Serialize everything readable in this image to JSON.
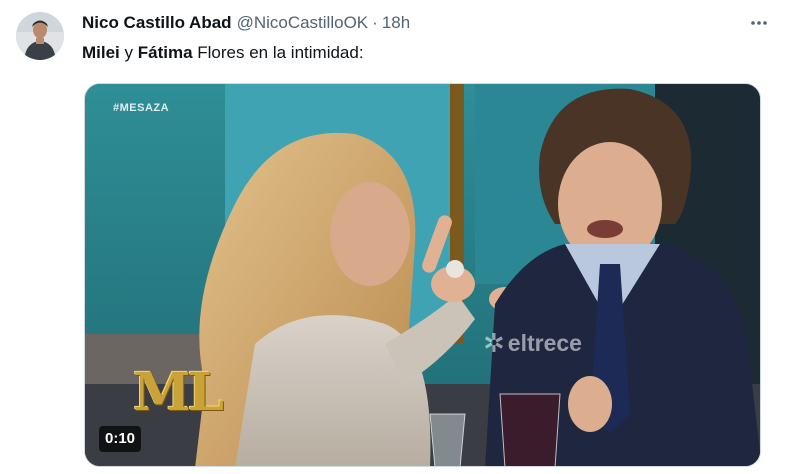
{
  "author": {
    "display_name": "Nico Castillo Abad",
    "handle": "@NicoCastilloOK",
    "separator": "·",
    "time": "18h"
  },
  "tweet": {
    "text_parts": [
      "Milei",
      " y ",
      "Fátima",
      " Flores en la intimidad:"
    ]
  },
  "media": {
    "channel_tag": "#MESAZA",
    "watermark": "eltrece",
    "show_logo": "ML",
    "duration": "0:10"
  },
  "icons": {
    "more": "more-horizontal-icon",
    "watermark_logo": "eltrece-logo-icon"
  },
  "colors": {
    "text_primary": "#0f1419",
    "text_secondary": "#536471",
    "border": "#cfd9de",
    "studio_teal": "#2a7f8a"
  }
}
